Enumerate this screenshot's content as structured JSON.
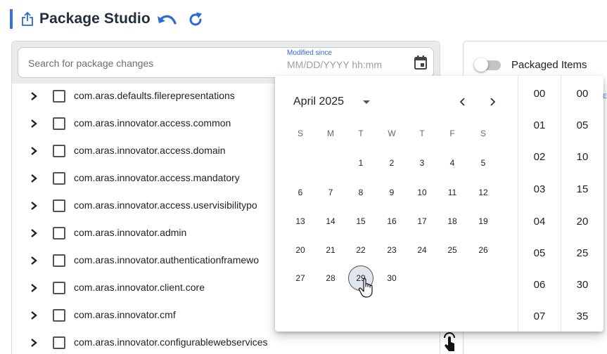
{
  "header": {
    "title": "Package Studio",
    "accent_color": "#3b73d8",
    "icons": [
      "export-icon",
      "undo-icon",
      "redo-icon"
    ]
  },
  "search": {
    "placeholder": "Search for package changes",
    "value": "",
    "modified_label": "Modified since",
    "modified_placeholder": "MM/DD/YYYY hh:mm"
  },
  "tree": {
    "items": [
      {
        "label": "com.aras.defaults.filerepresentations",
        "checked": false
      },
      {
        "label": "com.aras.innovator.access.common",
        "checked": false
      },
      {
        "label": "com.aras.innovator.access.domain",
        "checked": false
      },
      {
        "label": "com.aras.innovator.access.mandatory",
        "checked": false
      },
      {
        "label": "com.aras.innovator.access.uservisibilitypo",
        "checked": false
      },
      {
        "label": "com.aras.innovator.admin",
        "checked": false
      },
      {
        "label": "com.aras.innovator.authenticationframewo",
        "checked": false
      },
      {
        "label": "com.aras.innovator.client.core",
        "checked": false
      },
      {
        "label": "com.aras.innovator.cmf",
        "checked": false
      },
      {
        "label": "com.aras.innovator.configurablewebservices",
        "checked": false
      }
    ]
  },
  "packaged": {
    "label": "Packaged Items",
    "enabled": false,
    "cut_text": "E"
  },
  "datepicker": {
    "month_label": "April 2025",
    "weekdays": [
      "S",
      "M",
      "T",
      "W",
      "T",
      "F",
      "S"
    ],
    "weeks": [
      [
        "",
        "",
        "1",
        "2",
        "3",
        "4",
        "5"
      ],
      [
        "6",
        "7",
        "8",
        "9",
        "10",
        "11",
        "12"
      ],
      [
        "13",
        "14",
        "15",
        "16",
        "17",
        "18",
        "19"
      ],
      [
        "20",
        "21",
        "22",
        "23",
        "24",
        "25",
        "26"
      ],
      [
        "27",
        "28",
        "29",
        "30",
        "",
        "",
        ""
      ]
    ],
    "today": "29",
    "hours": [
      "00",
      "01",
      "02",
      "03",
      "04",
      "05",
      "06",
      "07"
    ],
    "minutes": [
      "00",
      "05",
      "10",
      "15",
      "20",
      "25",
      "30",
      "35"
    ]
  }
}
